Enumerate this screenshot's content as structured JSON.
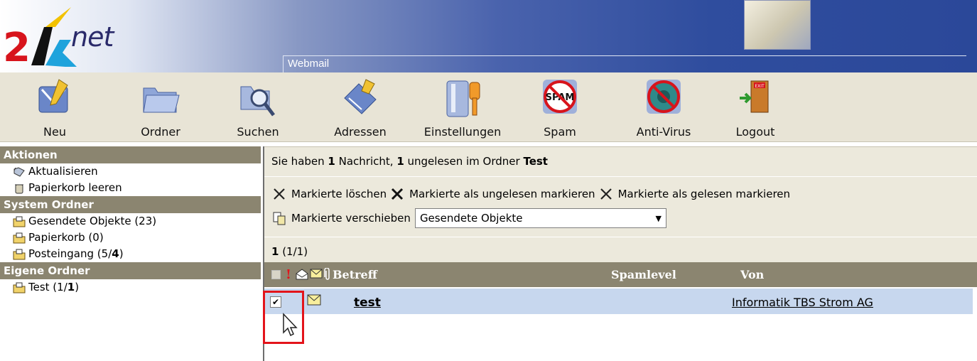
{
  "brand": {
    "logo_text": "net",
    "app_title": "Webmail"
  },
  "toolbar": [
    {
      "label": "Neu",
      "icon": "new-message-icon"
    },
    {
      "label": "Ordner",
      "icon": "folder-icon"
    },
    {
      "label": "Suchen",
      "icon": "search-icon"
    },
    {
      "label": "Adressen",
      "icon": "address-book-icon"
    },
    {
      "label": "Einstellungen",
      "icon": "settings-icon"
    },
    {
      "label": "Spam",
      "icon": "spam-icon"
    },
    {
      "label": "Anti-Virus",
      "icon": "anti-virus-icon"
    },
    {
      "label": "Logout",
      "icon": "logout-icon"
    }
  ],
  "sidebar": {
    "actions_title": "Aktionen",
    "actions": [
      "Aktualisieren",
      "Papierkorb leeren"
    ],
    "system_title": "System Ordner",
    "system_folders": [
      "Gesendete Objekte (23)",
      "Papierkorb (0)"
    ],
    "inbox": {
      "label": "Posteingang (5/",
      "unread": "4",
      "suffix": ")"
    },
    "own_title": "Eigene Ordner",
    "own_folder": {
      "label": "Test (1/",
      "unread": "1",
      "suffix": ")"
    }
  },
  "info": {
    "prefix": "Sie haben ",
    "count": "1",
    "mid": " Nachricht, ",
    "unread": "1",
    "mid2": " ungelesen im Ordner ",
    "folder": "Test"
  },
  "actions": {
    "delete": "Markierte löschen",
    "mark_unread": "Markierte als ungelesen markieren",
    "mark_read": "Markierte als gelesen markieren",
    "move": "Markierte verschieben",
    "move_target": "Gesendete Objekte"
  },
  "pager": {
    "page": "1",
    "range": " (1/1)"
  },
  "columns": {
    "subject": "Betreff",
    "spamlevel": "Spamlevel",
    "from": "Von"
  },
  "messages": [
    {
      "checked": true,
      "subject": "test",
      "from": "Informatik TBS Strom AG"
    }
  ],
  "colors": {
    "header_dark": "#2b4899",
    "section_head": "#8b8570",
    "row_selected": "#c7d7ee",
    "highlight": "#e3141b"
  }
}
